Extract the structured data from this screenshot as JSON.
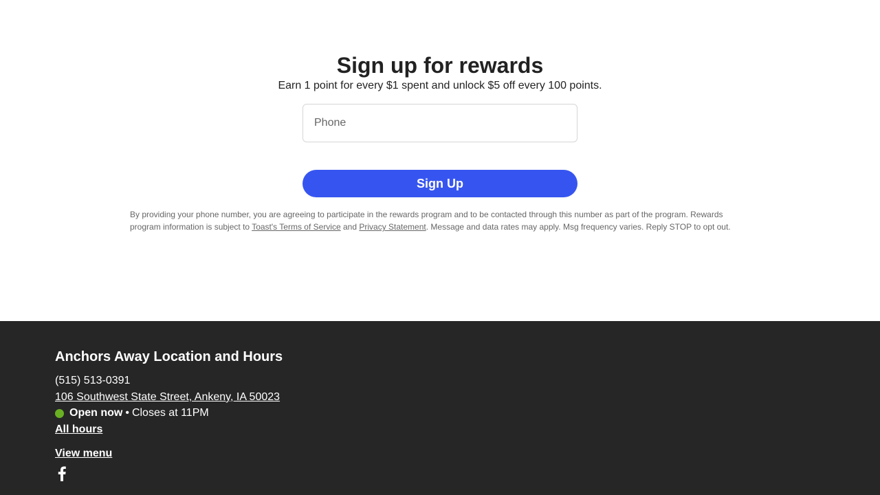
{
  "rewards": {
    "title": "Sign up for rewards",
    "subtitle": "Earn 1 point for every $1 spent and unlock $5 off every 100 points.",
    "phone_placeholder": "Phone",
    "phone_value": "",
    "signup_label": "Sign Up",
    "button_color": "#3655f0",
    "disclaimer": {
      "text_before": "By providing your phone number, you are agreeing to participate in the rewards program and to be contacted through this number as part of the program. Rewards program information is subject to ",
      "terms_link": "Toast's Terms of Service",
      "text_and": " and ",
      "privacy_link": "Privacy Statement",
      "text_after": ". Message and data rates may apply. Msg frequency varies. Reply STOP to opt out."
    }
  },
  "footer": {
    "background_color": "#262626",
    "location_title": "Anchors Away Location and Hours",
    "phone": "(515) 513-0391",
    "address": "106 Southwest State Street, Ankeny, IA 50023",
    "status": {
      "open_label": "Open now",
      "separator": "•",
      "closes_text": "Closes at 11PM",
      "indicator_color": "#6ab023"
    },
    "all_hours_label": "All hours",
    "view_menu_label": "View menu",
    "social_icon": "facebook-icon"
  }
}
